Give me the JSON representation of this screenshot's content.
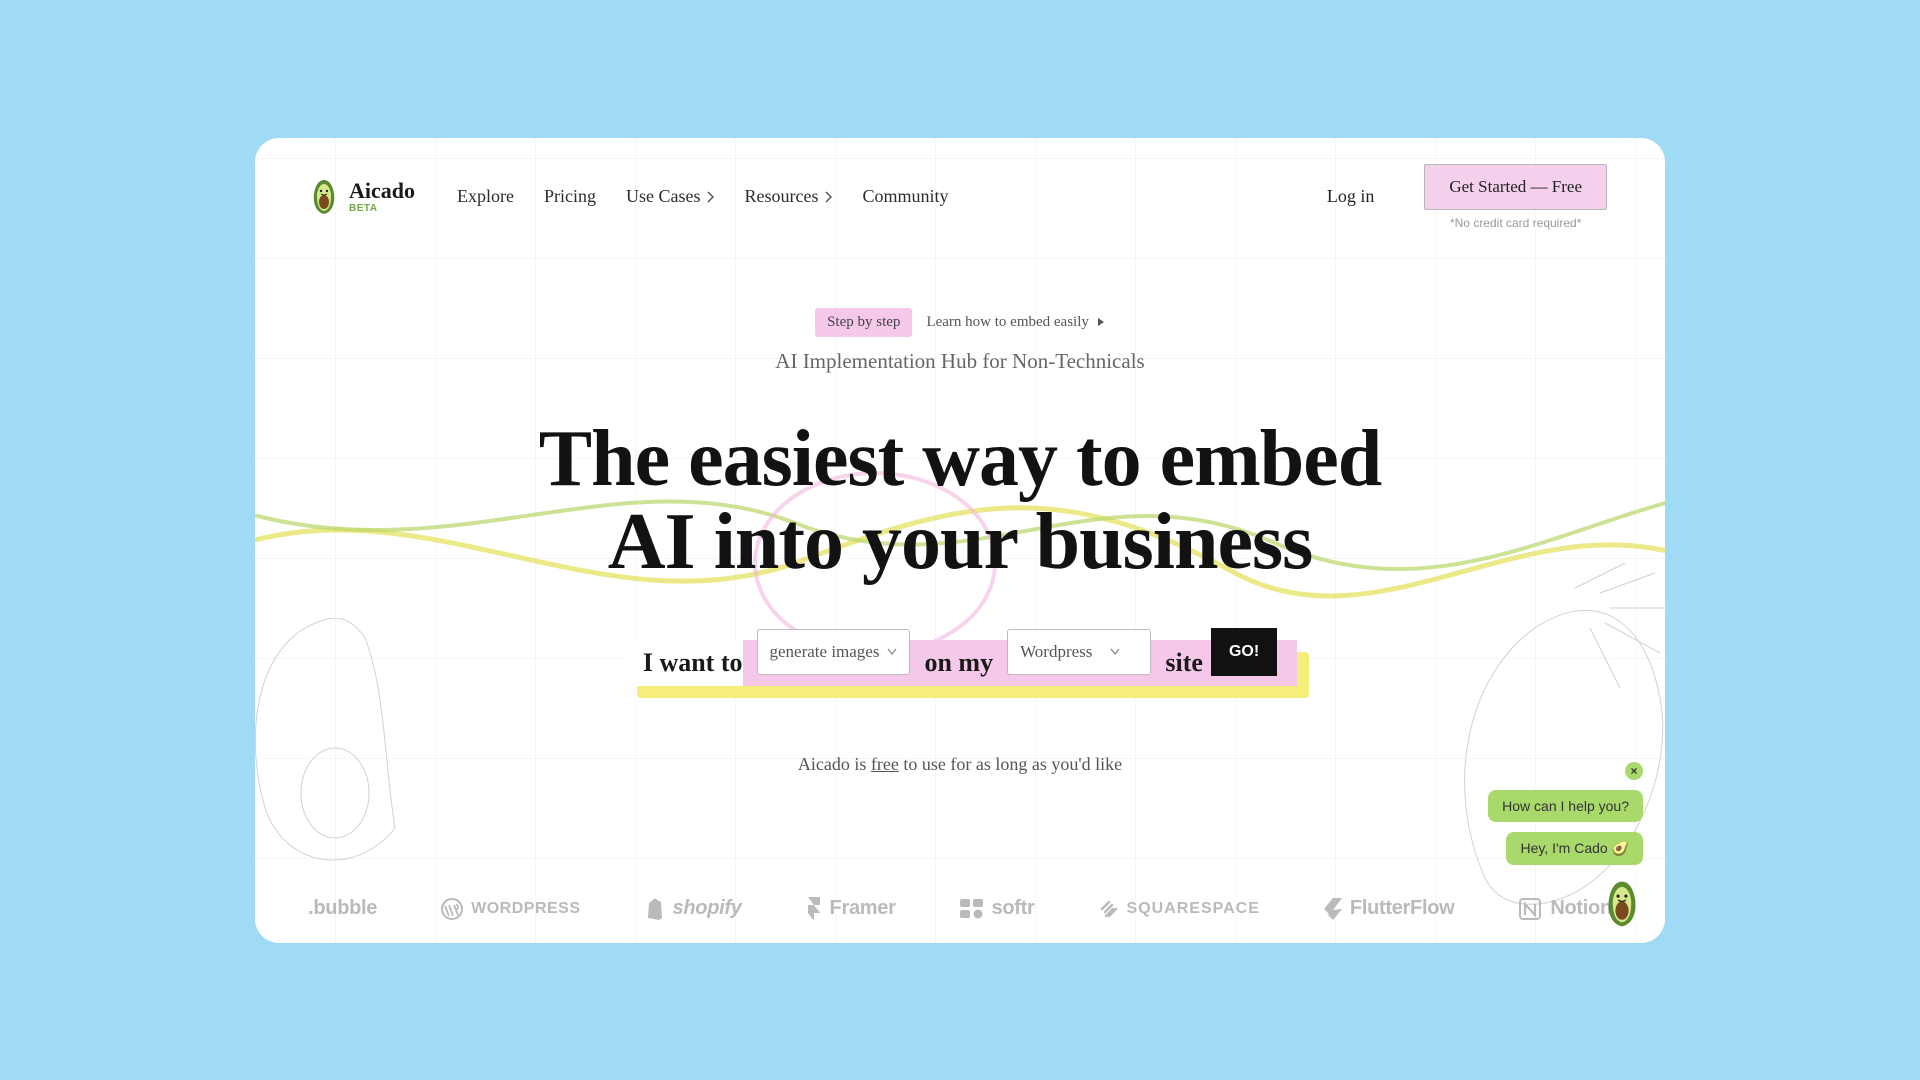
{
  "brand": {
    "name": "Aicado",
    "badge": "BETA"
  },
  "nav": {
    "explore": "Explore",
    "pricing": "Pricing",
    "usecases": "Use Cases",
    "resources": "Resources",
    "community": "Community"
  },
  "auth": {
    "login": "Log in",
    "cta": "Get Started — Free",
    "note": "*No credit card required*"
  },
  "hero": {
    "badge": "Step by step",
    "learn": "Learn how to embed easily",
    "tagline": "AI Implementation Hub for Non-Technicals",
    "headline1": "The easiest way to embed",
    "headline2": "AI into your business"
  },
  "form": {
    "lead": "I want to",
    "action": "generate images",
    "mid": "on my",
    "platform": "Wordpress",
    "trail": "site",
    "go": "GO!"
  },
  "freeline": {
    "pre": "Aicado is ",
    "free": "free",
    "post": " to use for as long as you'd like"
  },
  "logos": {
    "bubble": ".bubble",
    "wordpress": "WORDPRESS",
    "shopify": "shopify",
    "framer": "Framer",
    "softr": "softr",
    "squarespace": "SQUARESPACE",
    "flutterflow": "FlutterFlow",
    "notion": "Notion"
  },
  "chat": {
    "msg1": "How can I help you?",
    "msg2": "Hey, I'm Cado 🥑"
  }
}
